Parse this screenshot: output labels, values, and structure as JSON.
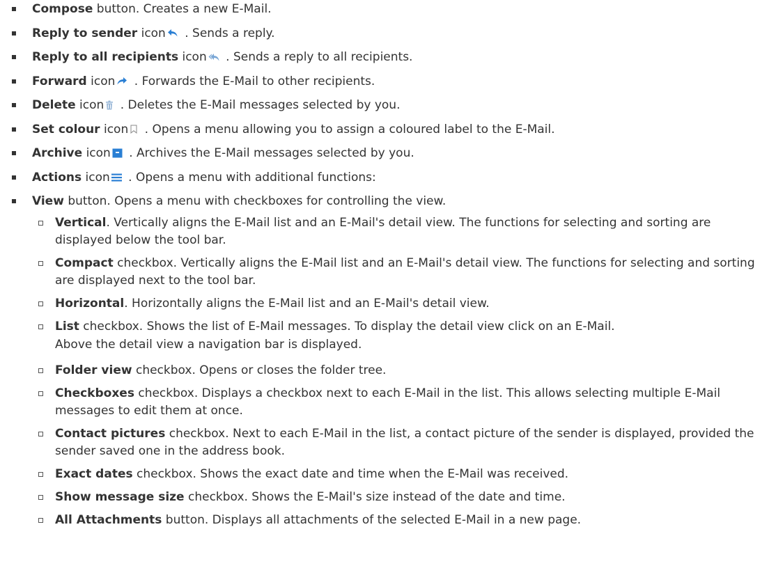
{
  "items": [
    {
      "bold": "Compose",
      "rest": " button. Creates a new E-Mail."
    },
    {
      "bold": "Reply to sender",
      "pre": " icon",
      "icon": "reply-icon",
      "rest": " . Sends a reply."
    },
    {
      "bold": "Reply to all recipients",
      "pre": " icon",
      "icon": "reply-all-icon",
      "rest": " . Sends a reply to all recipients."
    },
    {
      "bold": "Forward",
      "pre": " icon",
      "icon": "forward-icon",
      "rest": " . Forwards the E-Mail to other recipients."
    },
    {
      "bold": "Delete",
      "pre": " icon",
      "icon": "trash-icon",
      "rest": " . Deletes the E-Mail messages selected by you."
    },
    {
      "bold": "Set colour",
      "pre": " icon",
      "icon": "bookmark-icon",
      "rest": " . Opens a menu allowing you to assign a coloured label to the E-Mail."
    },
    {
      "bold": "Archive",
      "pre": " icon",
      "icon": "archive-icon",
      "rest": " . Archives the E-Mail messages selected by you."
    },
    {
      "bold": "Actions",
      "pre": " icon",
      "icon": "menu-icon",
      "rest": " . Opens a menu with additional functions:"
    },
    {
      "bold": "View",
      "rest": " button. Opens a menu with checkboxes for controlling the view."
    }
  ],
  "subitems": [
    {
      "bold": "Vertical",
      "rest": ". Vertically aligns the E-Mail list and an E-Mail's detail view. The functions for selecting and sorting are displayed below the tool bar."
    },
    {
      "bold": "Compact",
      "rest": " checkbox. Vertically aligns the E-Mail list and an E-Mail's detail view. The functions for selecting and sorting are displayed next to the tool bar."
    },
    {
      "bold": "Horizontal",
      "rest": ". Horizontally aligns the E-Mail list and an E-Mail's detail view."
    },
    {
      "bold": "List",
      "rest": " checkbox. Shows the list of E-Mail messages. To display the detail view click on an E-Mail.",
      "cont": "Above the detail view a navigation bar is displayed."
    },
    {
      "bold": "Folder view",
      "rest": " checkbox. Opens or closes the folder tree."
    },
    {
      "bold": "Checkboxes",
      "rest": " checkbox. Displays a checkbox next to each E-Mail in the list. This allows selecting multiple E-Mail messages to edit them at once."
    },
    {
      "bold": "Contact pictures",
      "rest": " checkbox. Next to each E-Mail in the list, a contact picture of the sender is displayed, provided the sender saved one in the address book."
    },
    {
      "bold": "Exact dates",
      "rest": " checkbox. Shows the exact date and time when the E-Mail was received."
    },
    {
      "bold": "Show message size",
      "rest": " checkbox. Shows the E-Mail's size instead of the date and time."
    },
    {
      "bold": "All Attachments",
      "rest": " button. Displays all attachments of the selected E-Mail in a new page."
    }
  ],
  "colors": {
    "text": "#333333",
    "icon_blue": "#2a7fd4",
    "icon_light": "#9ab8d8"
  }
}
